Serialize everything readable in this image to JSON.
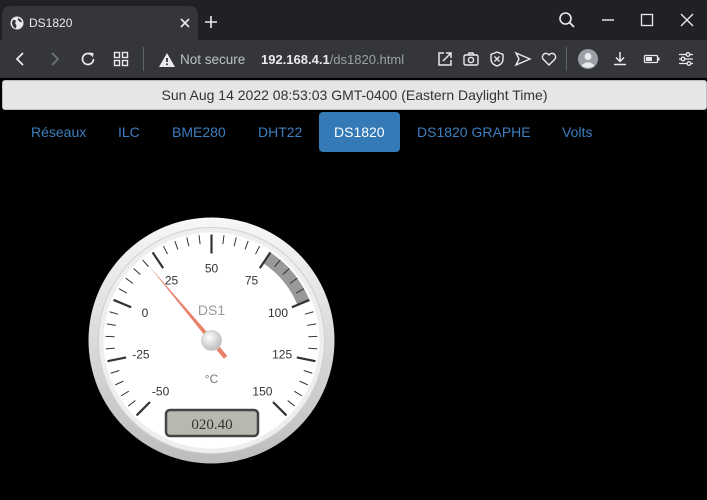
{
  "browser": {
    "tab_title": "DS1820",
    "security_label": "Not secure",
    "url_host": "192.168.4.1",
    "url_path": "/ds1820.html"
  },
  "page": {
    "datetime": "Sun Aug 14 2022 08:53:03 GMT-0400 (Eastern Daylight Time)",
    "nav_tabs": [
      {
        "label": "Réseaux",
        "active": false
      },
      {
        "label": "ILC",
        "active": false
      },
      {
        "label": "BME280",
        "active": false
      },
      {
        "label": "DHT22",
        "active": false
      },
      {
        "label": "DS1820",
        "active": true
      },
      {
        "label": "DS1820 GRAPHE",
        "active": false
      },
      {
        "label": "Volts",
        "active": false
      }
    ]
  },
  "gauge": {
    "title": "DS1",
    "units": "°C",
    "value": 20.4,
    "value_display": "020.40",
    "min": -50,
    "max": 150,
    "major_ticks": [
      "-50",
      "-25",
      "0",
      "25",
      "50",
      "75",
      "100",
      "125",
      "150"
    ],
    "highlight_from": 75,
    "highlight_to": 100,
    "highlight_color": "#999999",
    "needle_color": "#e8826a"
  }
}
